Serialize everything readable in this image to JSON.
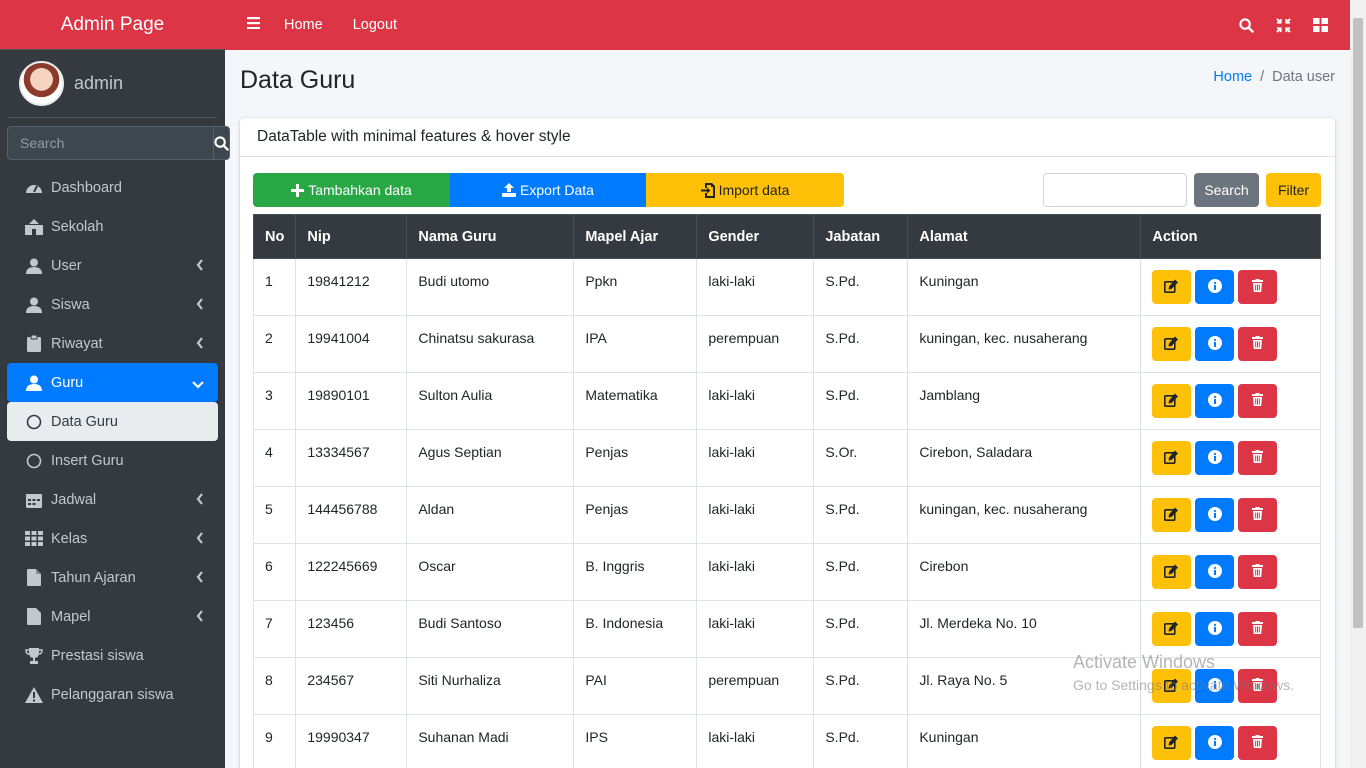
{
  "sidebar": {
    "brand": "Admin Page",
    "user_name": "admin",
    "search_placeholder": "Search",
    "items": [
      {
        "label": "Dashboard"
      },
      {
        "label": "Sekolah"
      },
      {
        "label": "User"
      },
      {
        "label": "Siswa"
      },
      {
        "label": "Riwayat"
      },
      {
        "label": "Guru"
      },
      {
        "label": "Data Guru"
      },
      {
        "label": "Insert Guru"
      },
      {
        "label": "Jadwal"
      },
      {
        "label": "Kelas"
      },
      {
        "label": "Tahun Ajaran"
      },
      {
        "label": "Mapel"
      },
      {
        "label": "Prestasi siswa"
      },
      {
        "label": "Pelanggaran siswa"
      }
    ]
  },
  "topbar": {
    "home": "Home",
    "logout": "Logout"
  },
  "page": {
    "title": "Data Guru",
    "breadcrumb_home": "Home",
    "breadcrumb_current": "Data user"
  },
  "card": {
    "header": "DataTable with minimal features & hover style",
    "btn_add": "Tambahkan data",
    "btn_export": "Export Data",
    "btn_import": "Import data",
    "btn_search": "Search",
    "btn_filter": "Filter"
  },
  "table": {
    "columns": [
      "No",
      "Nip",
      "Nama Guru",
      "Mapel Ajar",
      "Gender",
      "Jabatan",
      "Alamat",
      "Action"
    ],
    "rows": [
      [
        "1",
        "19841212",
        "Budi utomo",
        "Ppkn",
        "laki-laki",
        "S.Pd.",
        "Kuningan"
      ],
      [
        "2",
        "19941004",
        "Chinatsu sakurasa",
        "IPA",
        "perempuan",
        "S.Pd.",
        "kuningan, kec. nusaherang"
      ],
      [
        "3",
        "19890101",
        "Sulton Aulia",
        "Matematika",
        "laki-laki",
        "S.Pd.",
        "Jamblang"
      ],
      [
        "4",
        "13334567",
        "Agus Septian",
        "Penjas",
        "laki-laki",
        "S.Or.",
        "Cirebon, Saladara"
      ],
      [
        "5",
        "144456788",
        "Aldan",
        "Penjas",
        "laki-laki",
        "S.Pd.",
        "kuningan, kec. nusaherang"
      ],
      [
        "6",
        "122245669",
        "Oscar",
        "B. Inggris",
        "laki-laki",
        "S.Pd.",
        "Cirebon"
      ],
      [
        "7",
        "123456",
        "Budi Santoso",
        "B. Indonesia",
        "laki-laki",
        "S.Pd.",
        "Jl. Merdeka No. 10"
      ],
      [
        "8",
        "234567",
        "Siti Nurhaliza",
        "PAI",
        "perempuan",
        "S.Pd.",
        "Jl. Raya No. 5"
      ],
      [
        "9",
        "19990347",
        "Suhanan Madi",
        "IPS",
        "laki-laki",
        "S.Pd.",
        "Kuningan"
      ]
    ]
  },
  "watermark": {
    "line1": "Activate Windows",
    "line2": "Go to Settings to activate Windows."
  },
  "colors": {
    "danger": "#dc3545",
    "primary": "#007bff",
    "success": "#28a745",
    "warning": "#ffc107",
    "sidebar": "#343a40"
  }
}
